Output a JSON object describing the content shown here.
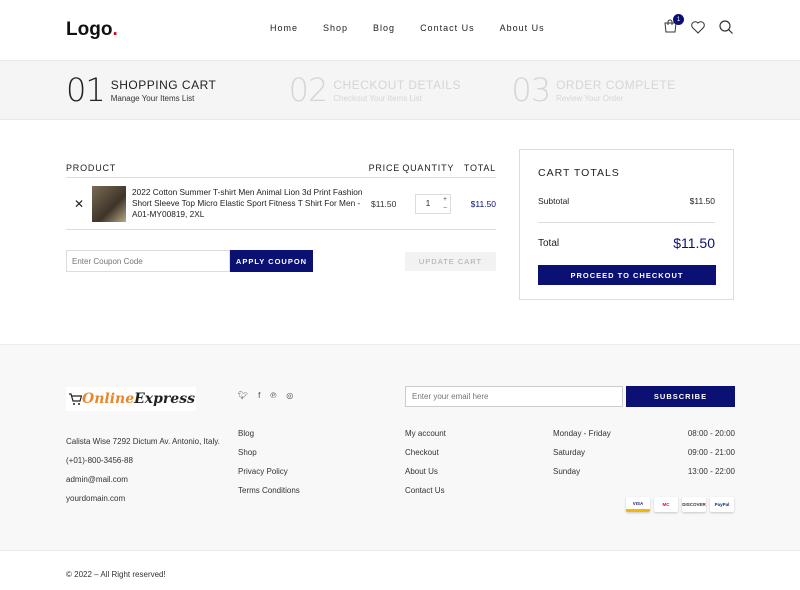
{
  "header": {
    "logo": "Logo",
    "logo_dot": ".",
    "nav": [
      "Home",
      "Shop",
      "Blog",
      "Contact Us",
      "About Us"
    ],
    "cart_count": "1"
  },
  "steps": [
    {
      "num": "01",
      "title": "SHOPPING CART",
      "sub": "Manage Your Items List"
    },
    {
      "num": "02",
      "title": "CHECKOUT DETAILS",
      "sub": "Checkout Your Items List"
    },
    {
      "num": "03",
      "title": "ORDER COMPLETE",
      "sub": "Review Your Order"
    }
  ],
  "cart": {
    "headers": {
      "product": "PRODUCT",
      "price": "PRICE",
      "quantity": "QUANTITY",
      "total": "TOTAL"
    },
    "item": {
      "remove": "✕",
      "name": "2022 Cotton Summer T-shirt Men Animal Lion 3d Print Fashion Short Sleeve Top Micro Elastic Sport Fitness T Shirt For Men - A01-MY00819, 2XL",
      "price": "$11.50",
      "quantity": "1",
      "plus": "+",
      "minus": "−",
      "total": "$11.50"
    },
    "coupon_placeholder": "Enter Coupon Code",
    "apply_coupon": "APPLY COUPON",
    "update_cart": "UPDATE CART"
  },
  "totals": {
    "title": "CART TOTALS",
    "subtotal_label": "Subtotal",
    "subtotal": "$11.50",
    "total_label": "Total",
    "total": "$11.50",
    "checkout": "PROCEED TO CHECKOUT"
  },
  "footer": {
    "brand_online": "Online",
    "brand_express": "Express",
    "address": "Calista Wise 7292 Dictum Av. Antonio, Italy.",
    "phone": "(+01)-800-3456-88",
    "email": "admin@mail.com",
    "domain": "yourdomain.com",
    "links1": [
      "Blog",
      "Shop",
      "Privacy Policy",
      "Terms Conditions"
    ],
    "links2": [
      "My account",
      "Checkout",
      "About Us",
      "Contact Us"
    ],
    "email_placeholder": "Enter your email here",
    "subscribe": "SUBSCRIBE",
    "hours": [
      {
        "day": "Monday - Friday",
        "time": "08:00 - 20:00"
      },
      {
        "day": "Saturday",
        "time": "09:00 - 21:00"
      },
      {
        "day": "Sunday",
        "time": "13:00 - 22:00"
      }
    ],
    "social_icons": [
      "twitter-icon",
      "facebook-icon",
      "pinterest-icon",
      "instagram-icon"
    ],
    "payment_cards": [
      "VISA",
      "MC",
      "DISCOVER",
      "PayPal"
    ],
    "copyright": "© 2022 – All Right reserved!"
  }
}
